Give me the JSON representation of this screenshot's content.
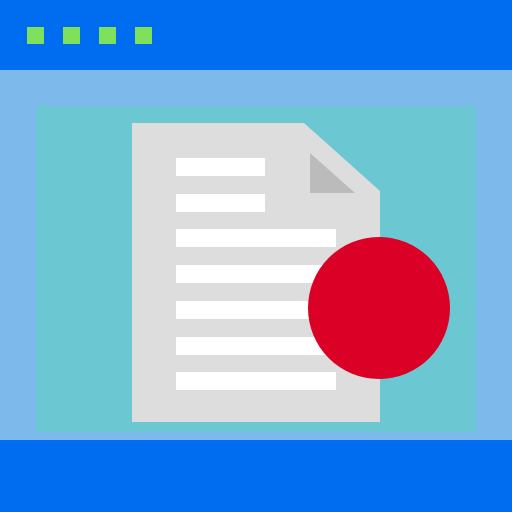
{
  "icon": {
    "name": "browser-document-record-icon",
    "dots": 4,
    "text_lines": 7
  },
  "colors": {
    "title_bar": "#006DF0",
    "window_frame": "#7EB9EB",
    "content_panel": "#6BC7D1",
    "page": "#DDDDDD",
    "page_fold": "#BBBBBB",
    "text_line": "#FFFFFF",
    "window_dots": "#7FE05C",
    "record_dot": "#DB0025",
    "bottom_bar": "#006DF0"
  }
}
